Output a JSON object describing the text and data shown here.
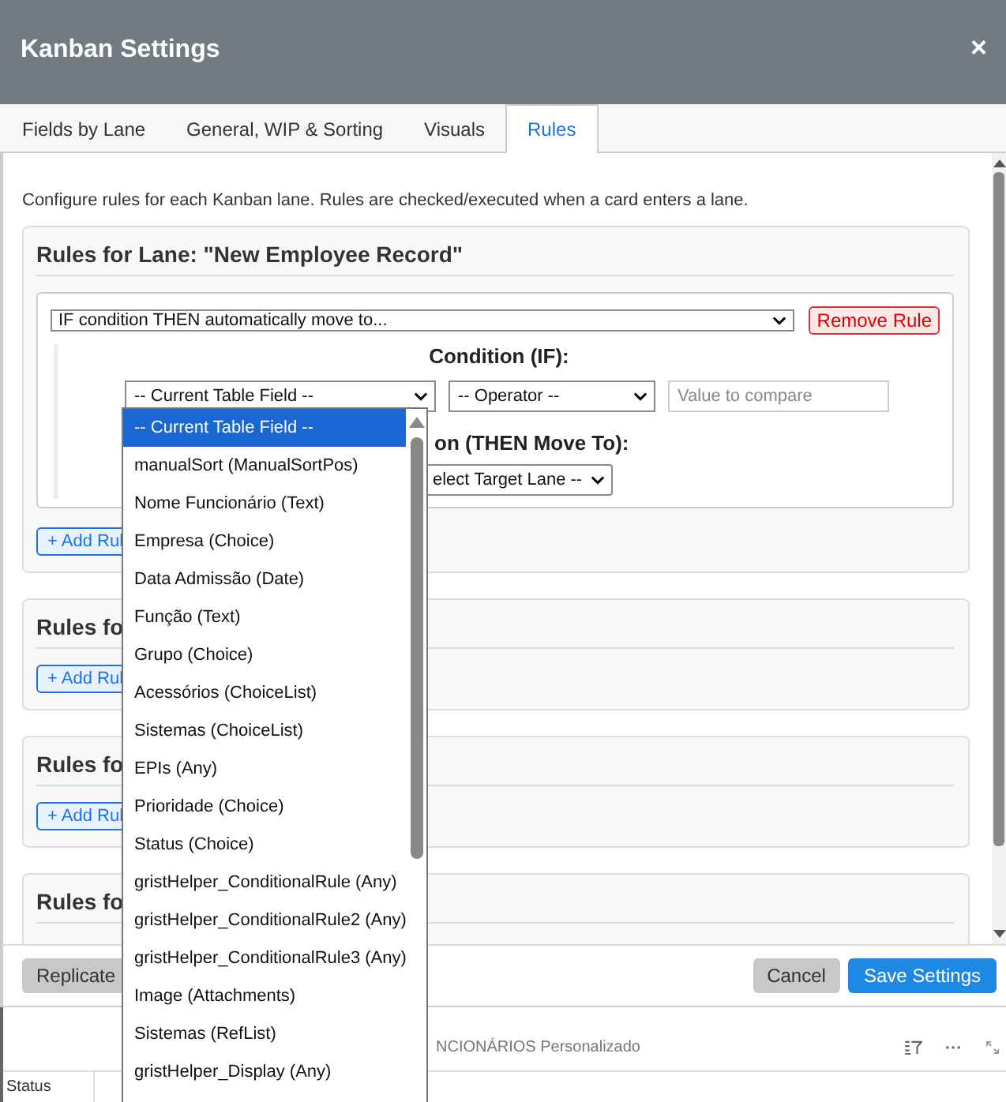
{
  "window": {
    "title": "Kanban Settings",
    "close": "×"
  },
  "tabs": [
    {
      "label": "Fields by Lane",
      "selected": false
    },
    {
      "label": "General, WIP & Sorting",
      "selected": false
    },
    {
      "label": "Visuals",
      "selected": false
    },
    {
      "label": "Rules",
      "selected": true
    }
  ],
  "description": "Configure rules for each Kanban lane. Rules are checked/executed when a card enters a lane.",
  "lanes": [
    {
      "title": "Rules for Lane: \"New Employee Record\"",
      "add_rule": "+ Add Rul",
      "rules": [
        {
          "rule_type": "IF condition THEN automatically move to...",
          "remove": "Remove Rule",
          "condition_heading": "Condition (IF):",
          "field": "-- Current Table Field --",
          "operator": "-- Operator --",
          "value_placeholder": "Value to compare",
          "action_heading": "on (THEN Move To):",
          "target": "elect Target Lane --"
        }
      ]
    },
    {
      "title": "Rules fo",
      "add_rule": "+ Add Rul"
    },
    {
      "title": "Rules fo",
      "add_rule": "+ Add Rul"
    },
    {
      "title": "Rules fo"
    }
  ],
  "field_dropdown": {
    "options": [
      {
        "label": "-- Current Table Field --",
        "selected": true
      },
      {
        "label": "manualSort (ManualSortPos)",
        "selected": false
      },
      {
        "label": "Nome Funcionário (Text)",
        "selected": false
      },
      {
        "label": "Empresa (Choice)",
        "selected": false
      },
      {
        "label": "Data Admissão (Date)",
        "selected": false
      },
      {
        "label": "Função (Text)",
        "selected": false
      },
      {
        "label": "Grupo (Choice)",
        "selected": false
      },
      {
        "label": "Acessórios (ChoiceList)",
        "selected": false
      },
      {
        "label": "Sistemas (ChoiceList)",
        "selected": false
      },
      {
        "label": "EPIs (Any)",
        "selected": false
      },
      {
        "label": "Prioridade (Choice)",
        "selected": false
      },
      {
        "label": "Status (Choice)",
        "selected": false
      },
      {
        "label": "gristHelper_ConditionalRule (Any)",
        "selected": false
      },
      {
        "label": "gristHelper_ConditionalRule2 (Any)",
        "selected": false
      },
      {
        "label": "gristHelper_ConditionalRule3 (Any)",
        "selected": false
      },
      {
        "label": "Image (Attachments)",
        "selected": false
      },
      {
        "label": "Sistemas (RefList)",
        "selected": false
      },
      {
        "label": "gristHelper_Display (Any)",
        "selected": false
      }
    ]
  },
  "footer": {
    "replicate": "Replicate",
    "cancel": "Cancel",
    "save": "Save Settings"
  },
  "background": {
    "view_title": "NCIONÁRIOS Personalizado",
    "column_header": "Status"
  }
}
